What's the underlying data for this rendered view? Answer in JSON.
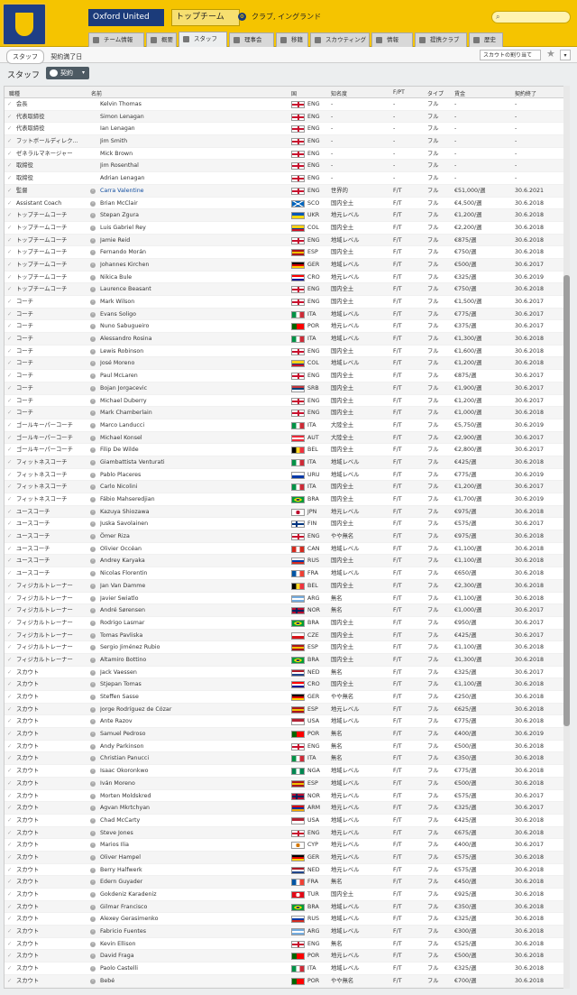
{
  "header": {
    "team_name": "Oxford United",
    "squad_label": "トップチーム",
    "club_sub": "クラブ, イングランド",
    "search_placeholder": "",
    "brand_color": "#f5c400",
    "navy": "#1b3b7a"
  },
  "tabs": [
    {
      "label": "チーム情報",
      "active": false
    },
    {
      "label": "概要",
      "active": false
    },
    {
      "label": "スタッフ",
      "active": true
    },
    {
      "label": "理事会",
      "active": false
    },
    {
      "label": "移籍",
      "active": false
    },
    {
      "label": "スカウティング",
      "active": false
    },
    {
      "label": "情報",
      "active": false
    },
    {
      "label": "提携クラブ",
      "active": false
    },
    {
      "label": "歴史",
      "active": false
    }
  ],
  "subbar": {
    "breadcrumb": "スタッフ",
    "breadcrumb2": "契約満了日",
    "dropdown": "スカウトの割り当て",
    "star_icon": "star-icon"
  },
  "view": {
    "title": "スタッフ",
    "filter_label": "契約"
  },
  "columns": [
    "職種",
    "名前",
    "国",
    "知名度",
    "F/PT",
    "タイプ",
    "賃金",
    "契約終了"
  ],
  "staff": [
    {
      "role": "会長",
      "name": "Kelvin Thomas",
      "nat": "ENG",
      "rep": "-",
      "ft": "-",
      "type": "フル",
      "wage": "-",
      "exp": "-"
    },
    {
      "role": "代表取締役",
      "name": "Simon Lenagan",
      "nat": "ENG",
      "rep": "-",
      "ft": "-",
      "type": "フル",
      "wage": "-",
      "exp": "-"
    },
    {
      "role": "代表取締役",
      "name": "Ian Lenagan",
      "nat": "ENG",
      "rep": "-",
      "ft": "-",
      "type": "フル",
      "wage": "-",
      "exp": "-"
    },
    {
      "role": "フットボールディレク...",
      "name": "Jim Smith",
      "nat": "ENG",
      "rep": "-",
      "ft": "-",
      "type": "フル",
      "wage": "-",
      "exp": "-"
    },
    {
      "role": "ゼネラルマネージャー",
      "name": "Mick Brown",
      "nat": "ENG",
      "rep": "-",
      "ft": "-",
      "type": "フル",
      "wage": "-",
      "exp": "-"
    },
    {
      "role": "取締役",
      "name": "Jim Rosenthal",
      "nat": "ENG",
      "rep": "-",
      "ft": "-",
      "type": "フル",
      "wage": "-",
      "exp": "-"
    },
    {
      "role": "取締役",
      "name": "Adrian Lenagan",
      "nat": "ENG",
      "rep": "-",
      "ft": "-",
      "type": "フル",
      "wage": "-",
      "exp": "-"
    },
    {
      "role": "監督",
      "name": "Carra Valentine",
      "nat": "ENG",
      "rep": "世界的",
      "ft": "F/T",
      "type": "フル",
      "wage": "€51,000/週",
      "exp": "30.6.2021",
      "link": true
    },
    {
      "role": "Assistant Coach",
      "name": "Brian McClair",
      "nat": "SCO",
      "rep": "国内全土",
      "ft": "F/T",
      "type": "フル",
      "wage": "€4,500/週",
      "exp": "30.6.2018"
    },
    {
      "role": "トップチームコーチ",
      "name": "Stepan Zgura",
      "nat": "UKR",
      "rep": "地元レベル",
      "ft": "F/T",
      "type": "フル",
      "wage": "€1,200/週",
      "exp": "30.6.2018"
    },
    {
      "role": "トップチームコーチ",
      "name": "Luis Gabriel Rey",
      "nat": "COL",
      "rep": "国内全土",
      "ft": "F/T",
      "type": "フル",
      "wage": "€2,200/週",
      "exp": "30.6.2018"
    },
    {
      "role": "トップチームコーチ",
      "name": "Jamie Reid",
      "nat": "ENG",
      "rep": "地域レベル",
      "ft": "F/T",
      "type": "フル",
      "wage": "€875/週",
      "exp": "30.6.2018"
    },
    {
      "role": "トップチームコーチ",
      "name": "Fernando Morán",
      "nat": "ESP",
      "rep": "国内全土",
      "ft": "F/T",
      "type": "フル",
      "wage": "€750/週",
      "exp": "30.6.2018"
    },
    {
      "role": "トップチームコーチ",
      "name": "Johannes Kirchen",
      "nat": "GER",
      "rep": "地域レベル",
      "ft": "F/T",
      "type": "フル",
      "wage": "€500/週",
      "exp": "30.6.2017"
    },
    {
      "role": "トップチームコーチ",
      "name": "Nikica Bule",
      "nat": "CRO",
      "rep": "地元レベル",
      "ft": "F/T",
      "type": "フル",
      "wage": "€325/週",
      "exp": "30.6.2019"
    },
    {
      "role": "トップチームコーチ",
      "name": "Laurence Beasant",
      "nat": "ENG",
      "rep": "国内全土",
      "ft": "F/T",
      "type": "フル",
      "wage": "€750/週",
      "exp": "30.6.2018"
    },
    {
      "role": "コーチ",
      "name": "Mark Wilson",
      "nat": "ENG",
      "rep": "国内全土",
      "ft": "F/T",
      "type": "フル",
      "wage": "€1,500/週",
      "exp": "30.6.2017"
    },
    {
      "role": "コーチ",
      "name": "Evans Soligo",
      "nat": "ITA",
      "rep": "地域レベル",
      "ft": "F/T",
      "type": "フル",
      "wage": "€775/週",
      "exp": "30.6.2017"
    },
    {
      "role": "コーチ",
      "name": "Nuno Sabugueiro",
      "nat": "POR",
      "rep": "地元レベル",
      "ft": "F/T",
      "type": "フル",
      "wage": "€375/週",
      "exp": "30.6.2017"
    },
    {
      "role": "コーチ",
      "name": "Alessandro Rosina",
      "nat": "ITA",
      "rep": "地域レベル",
      "ft": "F/T",
      "type": "フル",
      "wage": "€1,300/週",
      "exp": "30.6.2018"
    },
    {
      "role": "コーチ",
      "name": "Lewis Robinson",
      "nat": "ENG",
      "rep": "国内全土",
      "ft": "F/T",
      "type": "フル",
      "wage": "€1,600/週",
      "exp": "30.6.2018"
    },
    {
      "role": "コーチ",
      "name": "José Moreno",
      "nat": "COL",
      "rep": "地域レベル",
      "ft": "F/T",
      "type": "フル",
      "wage": "€1,200/週",
      "exp": "30.6.2018"
    },
    {
      "role": "コーチ",
      "name": "Paul McLaren",
      "nat": "ENG",
      "rep": "国内全土",
      "ft": "F/T",
      "type": "フル",
      "wage": "€875/週",
      "exp": "30.6.2017"
    },
    {
      "role": "コーチ",
      "name": "Bojan Jorgacevic",
      "nat": "SRB",
      "rep": "国内全土",
      "ft": "F/T",
      "type": "フル",
      "wage": "€1,900/週",
      "exp": "30.6.2017"
    },
    {
      "role": "コーチ",
      "name": "Michael Duberry",
      "nat": "ENG",
      "rep": "国内全土",
      "ft": "F/T",
      "type": "フル",
      "wage": "€1,200/週",
      "exp": "30.6.2017"
    },
    {
      "role": "コーチ",
      "name": "Mark Chamberlain",
      "nat": "ENG",
      "rep": "国内全土",
      "ft": "F/T",
      "type": "フル",
      "wage": "€1,000/週",
      "exp": "30.6.2018"
    },
    {
      "role": "ゴールキーパーコーチ",
      "name": "Marco Landucci",
      "nat": "ITA",
      "rep": "大陸全土",
      "ft": "F/T",
      "type": "フル",
      "wage": "€5,750/週",
      "exp": "30.6.2019"
    },
    {
      "role": "ゴールキーパーコーチ",
      "name": "Michael Konsel",
      "nat": "AUT",
      "rep": "大陸全土",
      "ft": "F/T",
      "type": "フル",
      "wage": "€2,900/週",
      "exp": "30.6.2017"
    },
    {
      "role": "ゴールキーパーコーチ",
      "name": "Filip De Wilde",
      "nat": "BEL",
      "rep": "国内全土",
      "ft": "F/T",
      "type": "フル",
      "wage": "€2,800/週",
      "exp": "30.6.2017"
    },
    {
      "role": "フィットネスコーチ",
      "name": "Giambattista Venturati",
      "nat": "ITA",
      "rep": "地域レベル",
      "ft": "F/T",
      "type": "フル",
      "wage": "€425/週",
      "exp": "30.6.2018"
    },
    {
      "role": "フィットネスコーチ",
      "name": "Pablo Placeres",
      "nat": "URU",
      "rep": "地域レベル",
      "ft": "F/T",
      "type": "フル",
      "wage": "€775/週",
      "exp": "30.6.2019"
    },
    {
      "role": "フィットネスコーチ",
      "name": "Carlo Nicolini",
      "nat": "ITA",
      "rep": "国内全土",
      "ft": "F/T",
      "type": "フル",
      "wage": "€1,200/週",
      "exp": "30.6.2017"
    },
    {
      "role": "フィットネスコーチ",
      "name": "Fábio Mahseredjian",
      "nat": "BRA",
      "rep": "国内全土",
      "ft": "F/T",
      "type": "フル",
      "wage": "€1,700/週",
      "exp": "30.6.2019"
    },
    {
      "role": "ユースコーチ",
      "name": "Kazuya Shiozawa",
      "nat": "JPN",
      "rep": "地元レベル",
      "ft": "F/T",
      "type": "フル",
      "wage": "€975/週",
      "exp": "30.6.2018"
    },
    {
      "role": "ユースコーチ",
      "name": "Juska Savolainen",
      "nat": "FIN",
      "rep": "国内全土",
      "ft": "F/T",
      "type": "フル",
      "wage": "€575/週",
      "exp": "30.6.2017"
    },
    {
      "role": "ユースコーチ",
      "name": "Ömer Riza",
      "nat": "ENG",
      "rep": "やや無名",
      "ft": "F/T",
      "type": "フル",
      "wage": "€975/週",
      "exp": "30.6.2018"
    },
    {
      "role": "ユースコーチ",
      "name": "Olivier Occéan",
      "nat": "CAN",
      "rep": "地域レベル",
      "ft": "F/T",
      "type": "フル",
      "wage": "€1,100/週",
      "exp": "30.6.2018"
    },
    {
      "role": "ユースコーチ",
      "name": "Andrey Karyaka",
      "nat": "RUS",
      "rep": "国内全土",
      "ft": "F/T",
      "type": "フル",
      "wage": "€1,100/週",
      "exp": "30.6.2018"
    },
    {
      "role": "ユースコーチ",
      "name": "Nicolas Florentin",
      "nat": "FRA",
      "rep": "地域レベル",
      "ft": "F/T",
      "type": "フル",
      "wage": "€650/週",
      "exp": "30.6.2018"
    },
    {
      "role": "フィジカルトレーナー",
      "name": "Jan Van Damme",
      "nat": "BEL",
      "rep": "国内全土",
      "ft": "F/T",
      "type": "フル",
      "wage": "€2,300/週",
      "exp": "30.6.2018"
    },
    {
      "role": "フィジカルトレーナー",
      "name": "Javier Swiatlo",
      "nat": "ARG",
      "rep": "無名",
      "ft": "F/T",
      "type": "フル",
      "wage": "€1,100/週",
      "exp": "30.6.2018"
    },
    {
      "role": "フィジカルトレーナー",
      "name": "André Sørensen",
      "nat": "NOR",
      "rep": "無名",
      "ft": "F/T",
      "type": "フル",
      "wage": "€1,000/週",
      "exp": "30.6.2017"
    },
    {
      "role": "フィジカルトレーナー",
      "name": "Rodrigo Lasmar",
      "nat": "BRA",
      "rep": "国内全土",
      "ft": "F/T",
      "type": "フル",
      "wage": "€950/週",
      "exp": "30.6.2017"
    },
    {
      "role": "フィジカルトレーナー",
      "name": "Tomas Pavliska",
      "nat": "CZE",
      "rep": "国内全土",
      "ft": "F/T",
      "type": "フル",
      "wage": "€425/週",
      "exp": "30.6.2017"
    },
    {
      "role": "フィジカルトレーナー",
      "name": "Sergio Jiménez Rubio",
      "nat": "ESP",
      "rep": "国内全土",
      "ft": "F/T",
      "type": "フル",
      "wage": "€1,100/週",
      "exp": "30.6.2018"
    },
    {
      "role": "フィジカルトレーナー",
      "name": "Altamiro Bottino",
      "nat": "BRA",
      "rep": "国内全土",
      "ft": "F/T",
      "type": "フル",
      "wage": "€1,300/週",
      "exp": "30.6.2018"
    },
    {
      "role": "スカウト",
      "name": "Jack Vaessen",
      "nat": "NED",
      "rep": "無名",
      "ft": "F/T",
      "type": "フル",
      "wage": "€325/週",
      "exp": "30.6.2017"
    },
    {
      "role": "スカウト",
      "name": "Stjepan Tomas",
      "nat": "CRO",
      "rep": "国内全土",
      "ft": "F/T",
      "type": "フル",
      "wage": "€1,100/週",
      "exp": "30.6.2018"
    },
    {
      "role": "スカウト",
      "name": "Steffen Sasse",
      "nat": "GER",
      "rep": "やや無名",
      "ft": "F/T",
      "type": "フル",
      "wage": "€250/週",
      "exp": "30.6.2018"
    },
    {
      "role": "スカウト",
      "name": "Jorge Rodríguez de Cózar",
      "nat": "ESP",
      "rep": "地元レベル",
      "ft": "F/T",
      "type": "フル",
      "wage": "€625/週",
      "exp": "30.6.2018"
    },
    {
      "role": "スカウト",
      "name": "Ante Razov",
      "nat": "USA",
      "rep": "地域レベル",
      "ft": "F/T",
      "type": "フル",
      "wage": "€775/週",
      "exp": "30.6.2018"
    },
    {
      "role": "スカウト",
      "name": "Samuel Pedroso",
      "nat": "POR",
      "rep": "無名",
      "ft": "F/T",
      "type": "フル",
      "wage": "€400/週",
      "exp": "30.6.2019"
    },
    {
      "role": "スカウト",
      "name": "Andy Parkinson",
      "nat": "ENG",
      "rep": "無名",
      "ft": "F/T",
      "type": "フル",
      "wage": "€500/週",
      "exp": "30.6.2018"
    },
    {
      "role": "スカウト",
      "name": "Christian Panucci",
      "nat": "ITA",
      "rep": "無名",
      "ft": "F/T",
      "type": "フル",
      "wage": "€350/週",
      "exp": "30.6.2018"
    },
    {
      "role": "スカウト",
      "name": "Isaac Okoronkwo",
      "nat": "NGA",
      "rep": "地域レベル",
      "ft": "F/T",
      "type": "フル",
      "wage": "€775/週",
      "exp": "30.6.2018"
    },
    {
      "role": "スカウト",
      "name": "Iván Moreno",
      "nat": "ESP",
      "rep": "地域レベル",
      "ft": "F/T",
      "type": "フル",
      "wage": "€500/週",
      "exp": "30.6.2018"
    },
    {
      "role": "スカウト",
      "name": "Morten Moldskred",
      "nat": "NOR",
      "rep": "地元レベル",
      "ft": "F/T",
      "type": "フル",
      "wage": "€575/週",
      "exp": "30.6.2017"
    },
    {
      "role": "スカウト",
      "name": "Agvan Mkrtchyan",
      "nat": "ARM",
      "rep": "地元レベル",
      "ft": "F/T",
      "type": "フル",
      "wage": "€325/週",
      "exp": "30.6.2017"
    },
    {
      "role": "スカウト",
      "name": "Chad McCarty",
      "nat": "USA",
      "rep": "地域レベル",
      "ft": "F/T",
      "type": "フル",
      "wage": "€425/週",
      "exp": "30.6.2018"
    },
    {
      "role": "スカウト",
      "name": "Steve Jones",
      "nat": "ENG",
      "rep": "地元レベル",
      "ft": "F/T",
      "type": "フル",
      "wage": "€675/週",
      "exp": "30.6.2018"
    },
    {
      "role": "スカウト",
      "name": "Marios Ilia",
      "nat": "CYP",
      "rep": "地元レベル",
      "ft": "F/T",
      "type": "フル",
      "wage": "€400/週",
      "exp": "30.6.2017"
    },
    {
      "role": "スカウト",
      "name": "Oliver Hampel",
      "nat": "GER",
      "rep": "地元レベル",
      "ft": "F/T",
      "type": "フル",
      "wage": "€575/週",
      "exp": "30.6.2018"
    },
    {
      "role": "スカウト",
      "name": "Berry Halfwerk",
      "nat": "NED",
      "rep": "地元レベル",
      "ft": "F/T",
      "type": "フル",
      "wage": "€575/週",
      "exp": "30.6.2018"
    },
    {
      "role": "スカウト",
      "name": "Edern Guyader",
      "nat": "FRA",
      "rep": "無名",
      "ft": "F/T",
      "type": "フル",
      "wage": "€450/週",
      "exp": "30.6.2018"
    },
    {
      "role": "スカウト",
      "name": "Gokdeniz Karadeniz",
      "nat": "TUR",
      "rep": "国内全土",
      "ft": "F/T",
      "type": "フル",
      "wage": "€925/週",
      "exp": "30.6.2018"
    },
    {
      "role": "スカウト",
      "name": "Gilmar Francisco",
      "nat": "BRA",
      "rep": "地域レベル",
      "ft": "F/T",
      "type": "フル",
      "wage": "€350/週",
      "exp": "30.6.2018"
    },
    {
      "role": "スカウト",
      "name": "Alexey Gerasimenko",
      "nat": "RUS",
      "rep": "地域レベル",
      "ft": "F/T",
      "type": "フル",
      "wage": "€325/週",
      "exp": "30.6.2018"
    },
    {
      "role": "スカウト",
      "name": "Fabricio Fuentes",
      "nat": "ARG",
      "rep": "地域レベル",
      "ft": "F/T",
      "type": "フル",
      "wage": "€300/週",
      "exp": "30.6.2018"
    },
    {
      "role": "スカウト",
      "name": "Kevin Ellison",
      "nat": "ENG",
      "rep": "無名",
      "ft": "F/T",
      "type": "フル",
      "wage": "€525/週",
      "exp": "30.6.2018"
    },
    {
      "role": "スカウト",
      "name": "David Fraga",
      "nat": "POR",
      "rep": "地元レベル",
      "ft": "F/T",
      "type": "フル",
      "wage": "€500/週",
      "exp": "30.6.2018"
    },
    {
      "role": "スカウト",
      "name": "Paolo Castelli",
      "nat": "ITA",
      "rep": "地域レベル",
      "ft": "F/T",
      "type": "フル",
      "wage": "€325/週",
      "exp": "30.6.2018"
    },
    {
      "role": "スカウト",
      "name": "Bebé",
      "nat": "POR",
      "rep": "やや無名",
      "ft": "F/T",
      "type": "フル",
      "wage": "€700/週",
      "exp": "30.6.2018"
    }
  ]
}
